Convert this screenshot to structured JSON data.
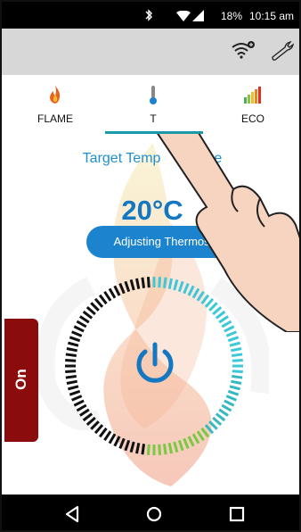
{
  "status_bar": {
    "battery": "18%",
    "time": "10:15 am"
  },
  "app_bar": {
    "wifi_icon": "wifi-settings-icon",
    "wrench_icon": "wrench-icon"
  },
  "tabs": [
    {
      "label": "FLAME",
      "icon": "flame-icon"
    },
    {
      "label": "T",
      "icon": "thermometer-icon"
    },
    {
      "label": "ECO",
      "icon": "signal-bars-icon"
    }
  ],
  "main": {
    "target_label": "Target Temp",
    "target_label_suffix": "e",
    "temperature": "20°C",
    "adjust_button": "Adjusting Thermosta"
  },
  "power": {
    "state_label": "On",
    "icon": "power-icon"
  },
  "colors": {
    "accent_blue": "#1477c2",
    "tab_underline": "#1a9aa8",
    "on_tab": "#8b0c0c",
    "ring_green": "#7ac943",
    "ring_cyan": "#3cc8d8"
  },
  "nav_bar": {
    "back_icon": "back-icon",
    "home_icon": "home-icon",
    "recents_icon": "recents-icon"
  }
}
